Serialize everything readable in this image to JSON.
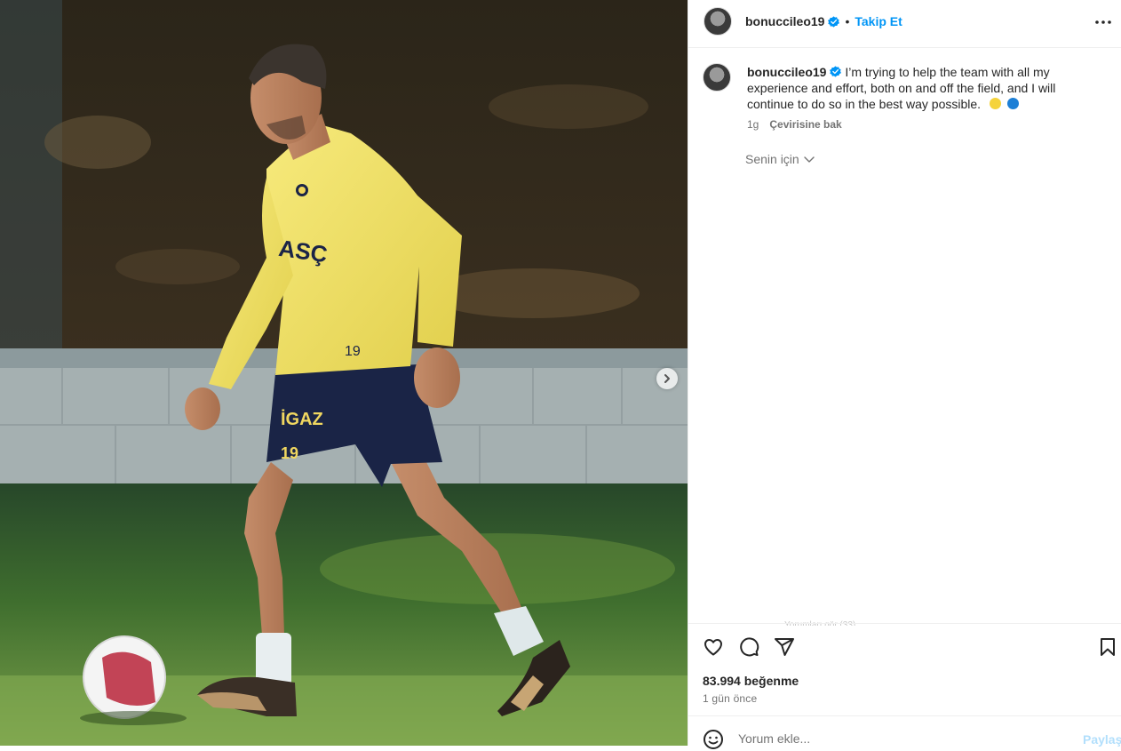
{
  "post": {
    "username": "bonuccileo19",
    "follow_label": "Takip Et",
    "separator": "•",
    "caption_text": "I’m trying to help the team with all my experience and effort, both on and off the field, and I will continue to do so in the best way possible.",
    "caption_emojis": [
      "yellow-circle",
      "blue-circle"
    ],
    "time_short": "1g",
    "translate_label": "Çevirisine bak",
    "for_you_label": "Senin için",
    "faded_comments_hint": "Yorumları gör (33)",
    "likes": "83.994 beğenme",
    "time_ago": "1 gün önce",
    "comment_placeholder": "Yorum ekle...",
    "share_label": "Paylaş"
  },
  "photo": {
    "jersey_number": "19",
    "jersey_sponsor": "İGAZ",
    "chest_text": "ASÇ",
    "colors": {
      "jersey": "#f2e46a",
      "shorts": "#1a2446",
      "grass": "#3d6b2c",
      "wall": "#a9b4b5"
    }
  },
  "colors": {
    "accent": "#0095f6",
    "verified": "#0095f6",
    "emoji_yellow": "#f5d33b",
    "emoji_blue": "#1d7fd6"
  },
  "icons": [
    "next-arrow-icon",
    "verified-badge-icon",
    "more-options-icon",
    "heart-icon",
    "comment-icon",
    "share-icon",
    "bookmark-icon",
    "emoji-icon",
    "chevron-down-icon"
  ]
}
